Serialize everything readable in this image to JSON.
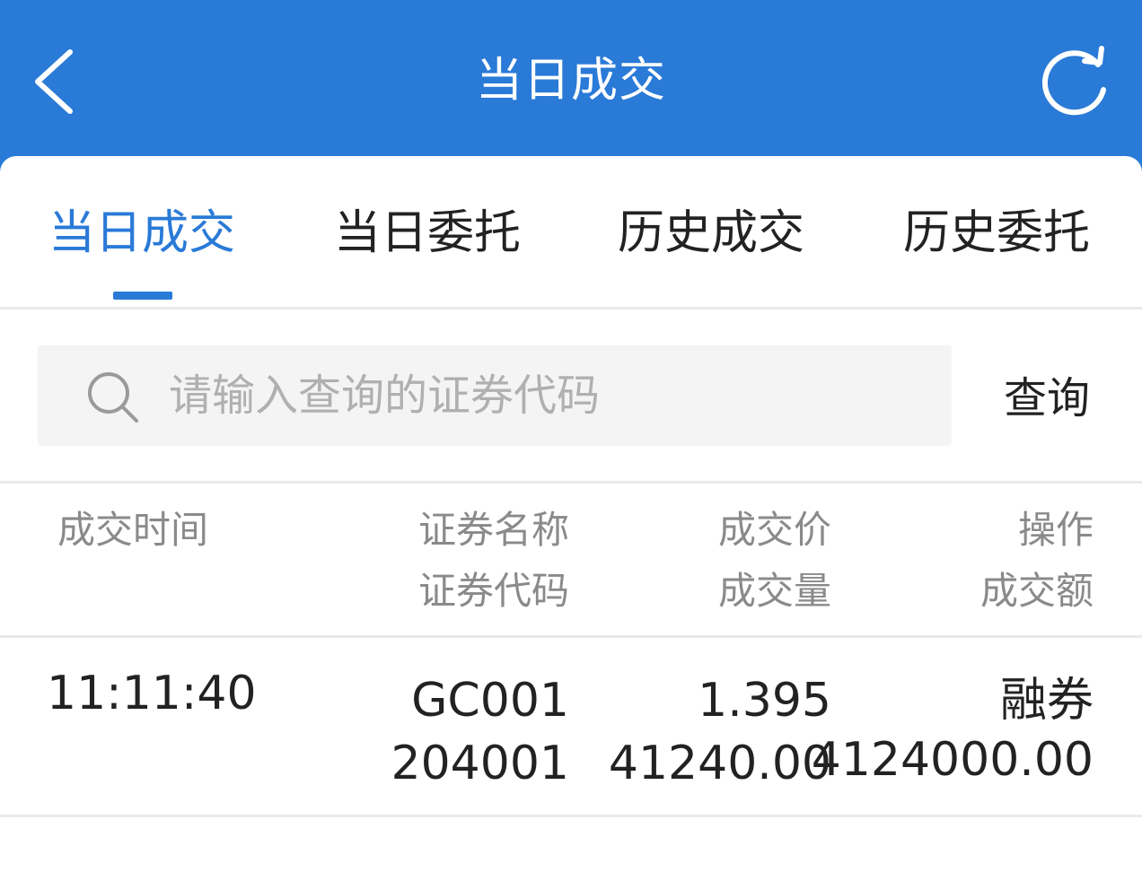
{
  "header": {
    "title": "当日成交",
    "back_icon": "chevron-left-icon",
    "refresh_icon": "refresh-icon"
  },
  "colors": {
    "primary": "#2a7ad7",
    "text": "#222222",
    "muted": "#8a8a8a",
    "placeholder": "#b0b0b0",
    "divider": "#e9e9e9",
    "search_bg": "#f4f4f4"
  },
  "tabs": [
    {
      "label": "当日成交",
      "active": true
    },
    {
      "label": "当日委托",
      "active": false
    },
    {
      "label": "历史成交",
      "active": false
    },
    {
      "label": "历史委托",
      "active": false
    }
  ],
  "search": {
    "placeholder": "请输入查询的证券代码",
    "value": "",
    "button_label": "查询",
    "icon": "search-icon"
  },
  "table": {
    "headers": {
      "time": "成交时间",
      "name": "证券名称",
      "code": "证券代码",
      "price": "成交价",
      "volume": "成交量",
      "operation": "操作",
      "amount": "成交额"
    },
    "rows": [
      {
        "time": "11:11:40",
        "name": "GC001",
        "code": "204001",
        "price": "1.395",
        "volume": "41240.00",
        "operation": "融券",
        "amount": "4124000.00"
      }
    ]
  }
}
